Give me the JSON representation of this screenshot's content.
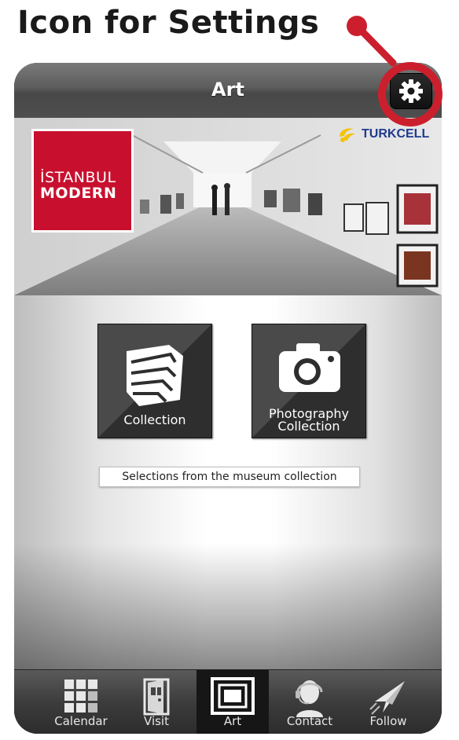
{
  "annotation": {
    "title": "Icon for Settings",
    "callout_color": "#cc1f2d"
  },
  "navbar": {
    "title": "Art",
    "settings_icon": "gear-icon"
  },
  "hero": {
    "logo_line1": "İSTANBUL",
    "logo_line2": "MODERN",
    "logo_color": "#c8102e",
    "sponsor": "TURKCELL",
    "sponsor_icon": "turkcell-logo-icon"
  },
  "content": {
    "tiles": [
      {
        "label": "Collection",
        "icon": "collection-icon"
      },
      {
        "label_line1": "Photography",
        "label_line2": "Collection",
        "icon": "camera-icon"
      }
    ],
    "caption": "Selections from the museum collection"
  },
  "tabbar": {
    "tabs": [
      {
        "label": "Calendar",
        "icon": "calendar-grid-icon"
      },
      {
        "label": "Visit",
        "icon": "door-icon"
      },
      {
        "label": "Art",
        "icon": "frame-icon",
        "active": true
      },
      {
        "label": "Contact",
        "icon": "headset-person-icon"
      },
      {
        "label": "Follow",
        "icon": "paper-plane-icon"
      }
    ]
  }
}
